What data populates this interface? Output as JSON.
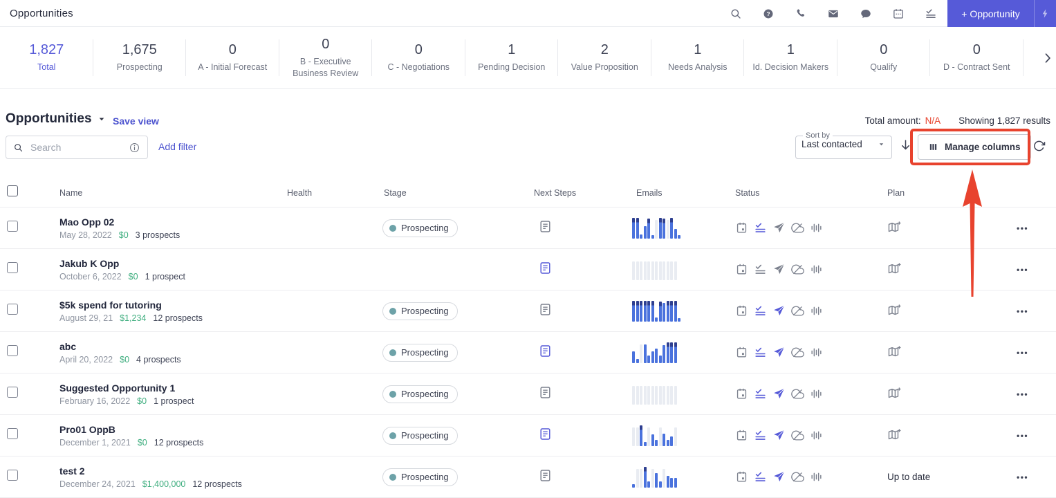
{
  "colors": {
    "accent": "#565ad8",
    "link": "#4c53cf",
    "annotation_red": "#e8432e",
    "amount_green": "#3fae7f",
    "na_red": "#e8432e",
    "stage_teal": "#6da2a8",
    "icon_grey": "#7b808d",
    "icon_active": "#565ad8",
    "bar_blue": "#4a72dd",
    "bar_grey": "#e9ecf2",
    "bar_cap": "#2e3f90"
  },
  "topbar": {
    "title": "Opportunities",
    "new_button": "+ Opportunity"
  },
  "pipeline": {
    "items": [
      {
        "value": "1,827",
        "label": "Total",
        "highlight": true
      },
      {
        "value": "1,675",
        "label": "Prospecting"
      },
      {
        "value": "0",
        "label": "A - Initial Forecast"
      },
      {
        "value": "0",
        "label": "B - Executive Business Review"
      },
      {
        "value": "0",
        "label": "C - Negotiations"
      },
      {
        "value": "1",
        "label": "Pending Decision"
      },
      {
        "value": "2",
        "label": "Value Proposition"
      },
      {
        "value": "1",
        "label": "Needs Analysis"
      },
      {
        "value": "1",
        "label": "Id. Decision Makers"
      },
      {
        "value": "0",
        "label": "Qualify"
      },
      {
        "value": "0",
        "label": "D - Contract Sent"
      }
    ]
  },
  "view": {
    "title": "Opportunities",
    "save_view": "Save view",
    "total_amount_label": "Total amount:",
    "total_amount_value": "N/A",
    "results": "Showing 1,827 results"
  },
  "toolbar": {
    "search_placeholder": "Search",
    "add_filter": "Add filter",
    "sort_label": "Sort by",
    "sort_value": "Last contacted",
    "manage_columns": "Manage columns"
  },
  "table": {
    "columns": [
      "Name",
      "Health",
      "Stage",
      "Next Steps",
      "Emails",
      "Status",
      "Plan"
    ],
    "rows": [
      {
        "name": "Mao Opp 02",
        "date": "May 28, 2022",
        "amount": "$0",
        "prospects": "3 prospects",
        "stage": "Prospecting",
        "next_steps_active": false,
        "plan": "",
        "emails": [
          {
            "v": 100,
            "c": "b"
          },
          {
            "v": 100,
            "c": "b"
          },
          {
            "v": 20,
            "c": "b"
          },
          {
            "v": 60,
            "c": "b"
          },
          {
            "v": 95,
            "c": "b"
          },
          {
            "v": 15,
            "c": "b"
          },
          {
            "v": 90,
            "c": "g"
          },
          {
            "v": 100,
            "c": "b"
          },
          {
            "v": 95,
            "c": "b"
          },
          {
            "v": 90,
            "c": "g"
          },
          {
            "v": 100,
            "c": "b"
          },
          {
            "v": 45,
            "c": "b"
          },
          {
            "v": 15,
            "c": "b"
          }
        ],
        "status": {
          "calendar": false,
          "tasks": true,
          "send": false,
          "cloud": false,
          "voice": false
        }
      },
      {
        "name": "Jakub K Opp",
        "date": "October 6, 2022",
        "amount": "$0",
        "prospects": "1 prospect",
        "stage": "",
        "next_steps_active": true,
        "plan": "",
        "emails": [
          {
            "v": 90,
            "c": "g"
          },
          {
            "v": 90,
            "c": "g"
          },
          {
            "v": 90,
            "c": "g"
          },
          {
            "v": 90,
            "c": "g"
          },
          {
            "v": 90,
            "c": "g"
          },
          {
            "v": 90,
            "c": "g"
          },
          {
            "v": 90,
            "c": "g"
          },
          {
            "v": 90,
            "c": "g"
          },
          {
            "v": 90,
            "c": "g"
          },
          {
            "v": 90,
            "c": "g"
          },
          {
            "v": 90,
            "c": "g"
          },
          {
            "v": 90,
            "c": "g"
          }
        ],
        "status": {
          "calendar": false,
          "tasks": false,
          "send": false,
          "cloud": false,
          "voice": false
        }
      },
      {
        "name": "$5k spend for tutoring",
        "date": "August 29, 21",
        "amount": "$1,234",
        "prospects": "12 prospects",
        "stage": "Prospecting",
        "next_steps_active": false,
        "plan": "",
        "emails": [
          {
            "v": 100,
            "c": "b"
          },
          {
            "v": 100,
            "c": "b"
          },
          {
            "v": 100,
            "c": "b"
          },
          {
            "v": 100,
            "c": "b"
          },
          {
            "v": 100,
            "c": "b"
          },
          {
            "v": 100,
            "c": "b"
          },
          {
            "v": 20,
            "c": "b"
          },
          {
            "v": 95,
            "c": "b"
          },
          {
            "v": 90,
            "c": "b"
          },
          {
            "v": 100,
            "c": "b"
          },
          {
            "v": 100,
            "c": "b"
          },
          {
            "v": 100,
            "c": "b"
          },
          {
            "v": 15,
            "c": "b"
          }
        ],
        "status": {
          "calendar": false,
          "tasks": true,
          "send": true,
          "cloud": false,
          "voice": false
        }
      },
      {
        "name": "abc",
        "date": "April 20, 2022",
        "amount": "$0",
        "prospects": "4 prospects",
        "stage": "Prospecting",
        "next_steps_active": true,
        "plan": "",
        "emails": [
          {
            "v": 55,
            "c": "b"
          },
          {
            "v": 18,
            "c": "b"
          },
          {
            "v": 90,
            "c": "g"
          },
          {
            "v": 90,
            "c": "b"
          },
          {
            "v": 35,
            "c": "b"
          },
          {
            "v": 55,
            "c": "b"
          },
          {
            "v": 70,
            "c": "b"
          },
          {
            "v": 35,
            "c": "b"
          },
          {
            "v": 85,
            "c": "b"
          },
          {
            "v": 100,
            "c": "b"
          },
          {
            "v": 100,
            "c": "b"
          },
          {
            "v": 100,
            "c": "b"
          }
        ],
        "status": {
          "calendar": false,
          "tasks": true,
          "send": true,
          "cloud": false,
          "voice": false
        }
      },
      {
        "name": "Suggested Opportunity 1",
        "date": "February 16, 2022",
        "amount": "$0",
        "prospects": "1 prospect",
        "stage": "Prospecting",
        "next_steps_active": false,
        "plan": "",
        "emails": [
          {
            "v": 90,
            "c": "g"
          },
          {
            "v": 90,
            "c": "g"
          },
          {
            "v": 90,
            "c": "g"
          },
          {
            "v": 90,
            "c": "g"
          },
          {
            "v": 90,
            "c": "g"
          },
          {
            "v": 90,
            "c": "g"
          },
          {
            "v": 90,
            "c": "g"
          },
          {
            "v": 90,
            "c": "g"
          },
          {
            "v": 90,
            "c": "g"
          },
          {
            "v": 90,
            "c": "g"
          },
          {
            "v": 90,
            "c": "g"
          },
          {
            "v": 90,
            "c": "g"
          }
        ],
        "status": {
          "calendar": false,
          "tasks": true,
          "send": true,
          "cloud": false,
          "voice": false
        }
      },
      {
        "name": "Pro01 OppB",
        "date": "December 1, 2021",
        "amount": "$0",
        "prospects": "12 prospects",
        "stage": "Prospecting",
        "next_steps_active": true,
        "plan": "",
        "emails": [
          {
            "v": 90,
            "c": "g"
          },
          {
            "v": 90,
            "c": "g"
          },
          {
            "v": 100,
            "c": "b"
          },
          {
            "v": 18,
            "c": "b"
          },
          {
            "v": 90,
            "c": "g"
          },
          {
            "v": 55,
            "c": "b"
          },
          {
            "v": 30,
            "c": "b"
          },
          {
            "v": 90,
            "c": "g"
          },
          {
            "v": 60,
            "c": "b"
          },
          {
            "v": 30,
            "c": "b"
          },
          {
            "v": 45,
            "c": "b"
          },
          {
            "v": 90,
            "c": "g"
          }
        ],
        "status": {
          "calendar": false,
          "tasks": true,
          "send": true,
          "cloud": false,
          "voice": false
        }
      },
      {
        "name": "test 2",
        "date": "December 24, 2021",
        "amount": "$1,400,000",
        "prospects": "12 prospects",
        "stage": "Prospecting",
        "next_steps_active": false,
        "plan": "Up to date",
        "emails": [
          {
            "v": 15,
            "c": "b"
          },
          {
            "v": 90,
            "c": "g"
          },
          {
            "v": 90,
            "c": "g"
          },
          {
            "v": 100,
            "c": "b"
          },
          {
            "v": 30,
            "c": "b"
          },
          {
            "v": 90,
            "c": "g"
          },
          {
            "v": 70,
            "c": "b"
          },
          {
            "v": 30,
            "c": "b"
          },
          {
            "v": 90,
            "c": "g"
          },
          {
            "v": 55,
            "c": "b"
          },
          {
            "v": 45,
            "c": "b"
          },
          {
            "v": 45,
            "c": "b"
          }
        ],
        "status": {
          "calendar": false,
          "tasks": true,
          "send": true,
          "cloud": false,
          "voice": false
        }
      }
    ]
  }
}
